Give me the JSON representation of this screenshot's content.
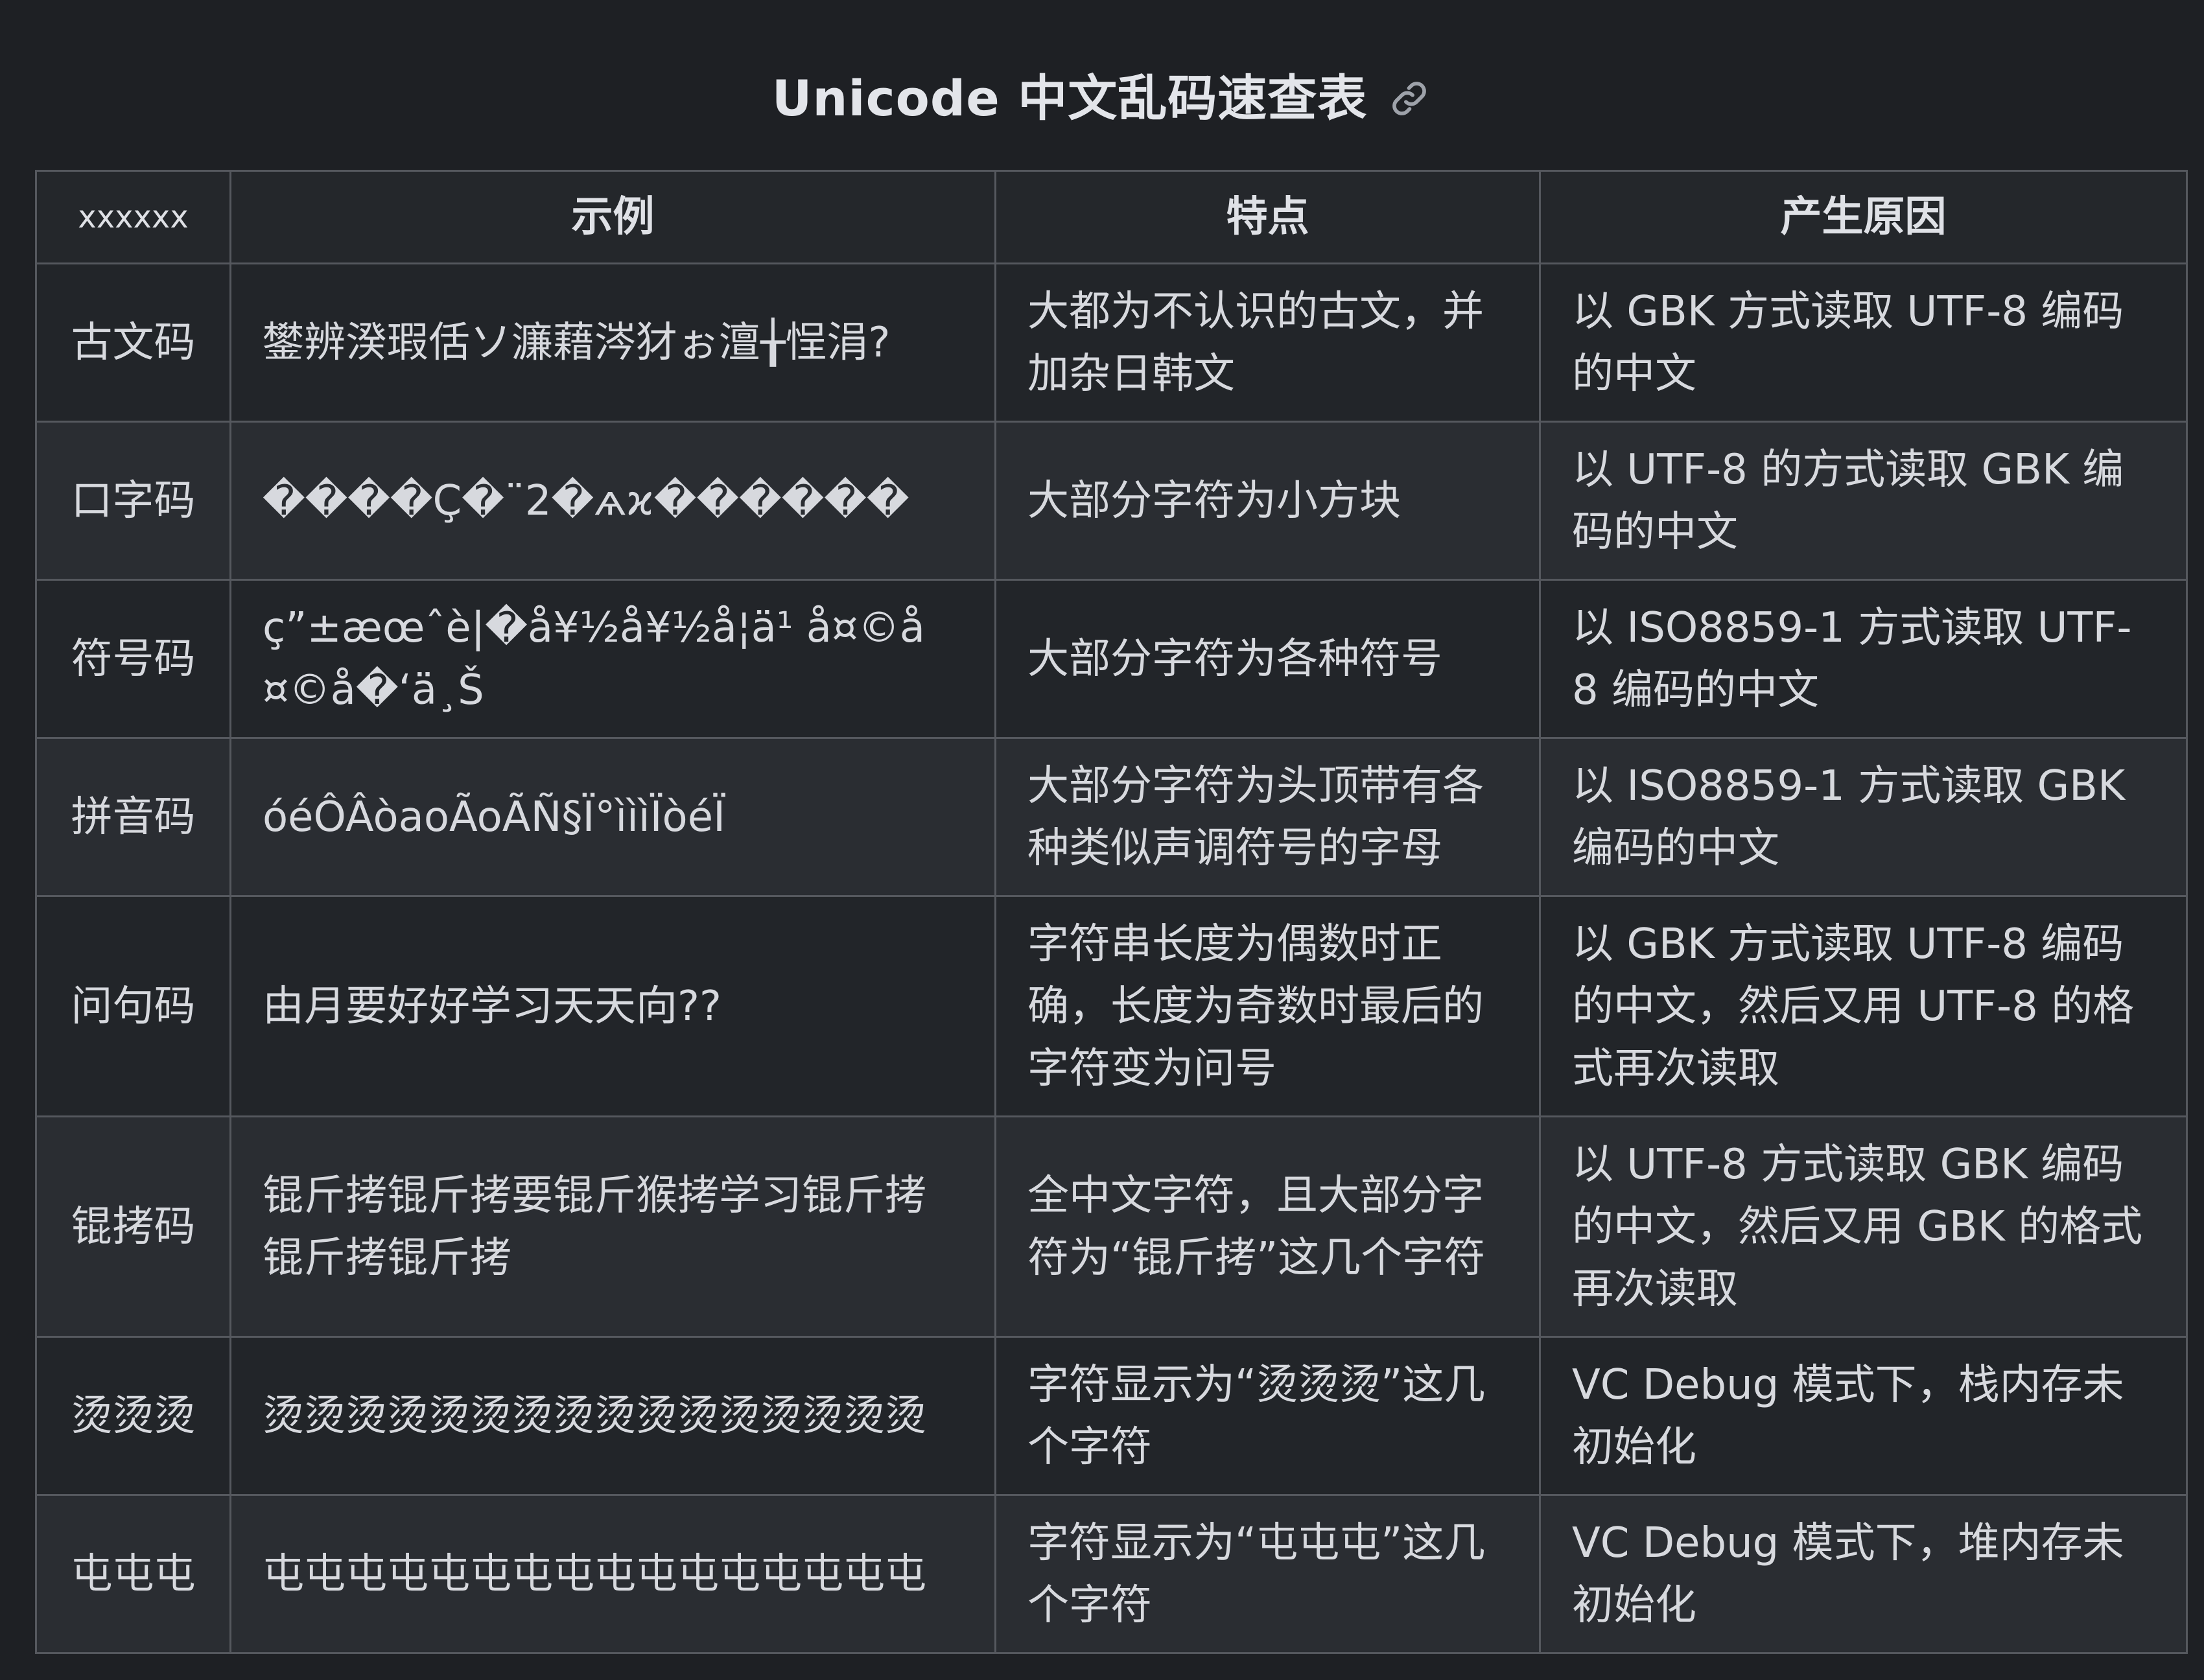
{
  "title": "Unicode 中文乱码速查表",
  "link_icon": "link-icon",
  "columns": [
    "xxxxxx",
    "示例",
    "特点",
    "产生原因"
  ],
  "rows": [
    {
      "name": "古文码",
      "example": "鐢辨湀瑕佸ソ濂藉涔犲ぉ澶╁悜涓?",
      "feature": "大都为不认识的古文，并加杂日韩文",
      "cause": "以 GBK 方式读取 UTF-8 编码的中文"
    },
    {
      "name": "口字码",
      "example": "����Ç�¨2�ѧϰ������",
      "feature": "大部分字符为小方块",
      "cause": "以 UTF-8 的方式读取 GBK 编码的中文"
    },
    {
      "name": "符号码",
      "example": "ç”±æœˆè|�å¥½å¥½å­¦ä¹ å¤©å¤©å�‘ä¸Š",
      "feature": "大部分字符为各种符号",
      "cause": "以 ISO8859-1 方式读取 UTF-8 编码的中文"
    },
    {
      "name": "拼音码",
      "example": "óéÔÂòaoÃoÃÑ§Ï°ìììÏòéÏ",
      "feature": "大部分字符为头顶带有各种类似声调符号的字母",
      "cause": "以 ISO8859-1 方式读取 GBK 编码的中文"
    },
    {
      "name": "问句码",
      "example": "由月要好好学习天天向??",
      "feature": "字符串长度为偶数时正确，长度为奇数时最后的字符变为问号",
      "cause": "以 GBK 方式读取 UTF-8 编码的中文，然后又用 UTF-8 的格式再次读取"
    },
    {
      "name": "锟拷码",
      "example": "锟斤拷锟斤拷要锟斤猴拷学习锟斤拷锟斤拷锟斤拷",
      "feature": "全中文字符，且大部分字符为“锟斤拷”这几个字符",
      "cause": "以 UTF-8 方式读取 GBK 编码的中文，然后又用 GBK 的格式再次读取"
    },
    {
      "name": "烫烫烫",
      "example": "烫烫烫烫烫烫烫烫烫烫烫烫烫烫烫烫",
      "feature": "字符显示为“烫烫烫”这几个字符",
      "cause": "VC Debug 模式下，栈内存未初始化"
    },
    {
      "name": "屯屯屯",
      "example": "屯屯屯屯屯屯屯屯屯屯屯屯屯屯屯屯",
      "feature": "字符显示为“屯屯屯”这几个字符",
      "cause": "VC Debug 模式下，堆内存未初始化"
    }
  ]
}
